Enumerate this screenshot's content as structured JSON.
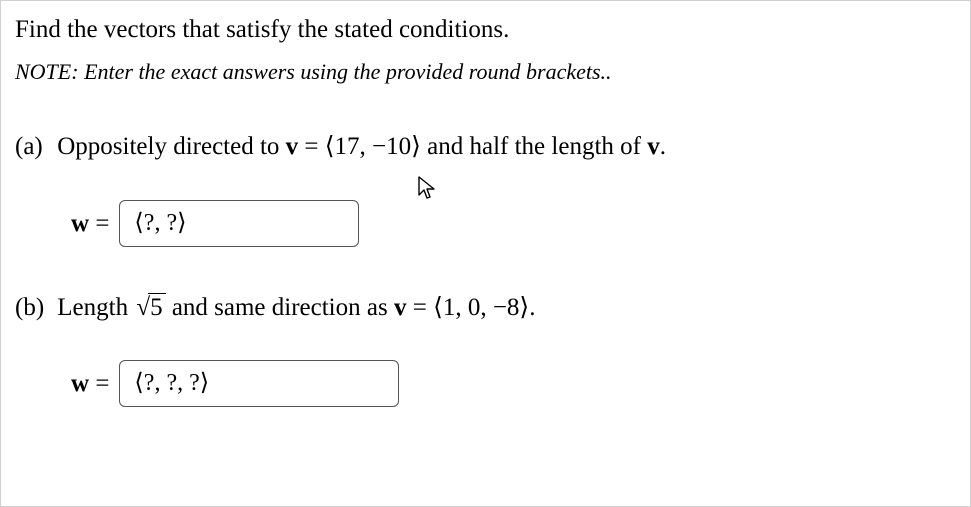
{
  "prompt": "Find the vectors that satisfy the stated conditions.",
  "note_prefix": "NOTE:",
  "note_body": " Enter the exact answers using the provided round brackets..",
  "parts": {
    "a": {
      "label": "(a)",
      "text_before_v": " Oppositely directed to ",
      "v_label": "v",
      "eq": " = ",
      "vector": "⟨17, −10⟩",
      "text_after": " and half the length of ",
      "v_label2": "v",
      "period": ".",
      "answer": {
        "w_label": "w",
        "eq": " = ",
        "placeholder": "⟨?, ?⟩"
      }
    },
    "b": {
      "label": "(b)",
      "text_before_len": " Length ",
      "sqrt_sym": "√",
      "radicand": "5",
      "text_mid": " and same direction as ",
      "v_label": "v",
      "eq": " = ",
      "vector": "⟨1, 0, −8⟩",
      "period": ".",
      "answer": {
        "w_label": "w",
        "eq": " = ",
        "placeholder": "⟨?, ?, ?⟩"
      }
    }
  }
}
